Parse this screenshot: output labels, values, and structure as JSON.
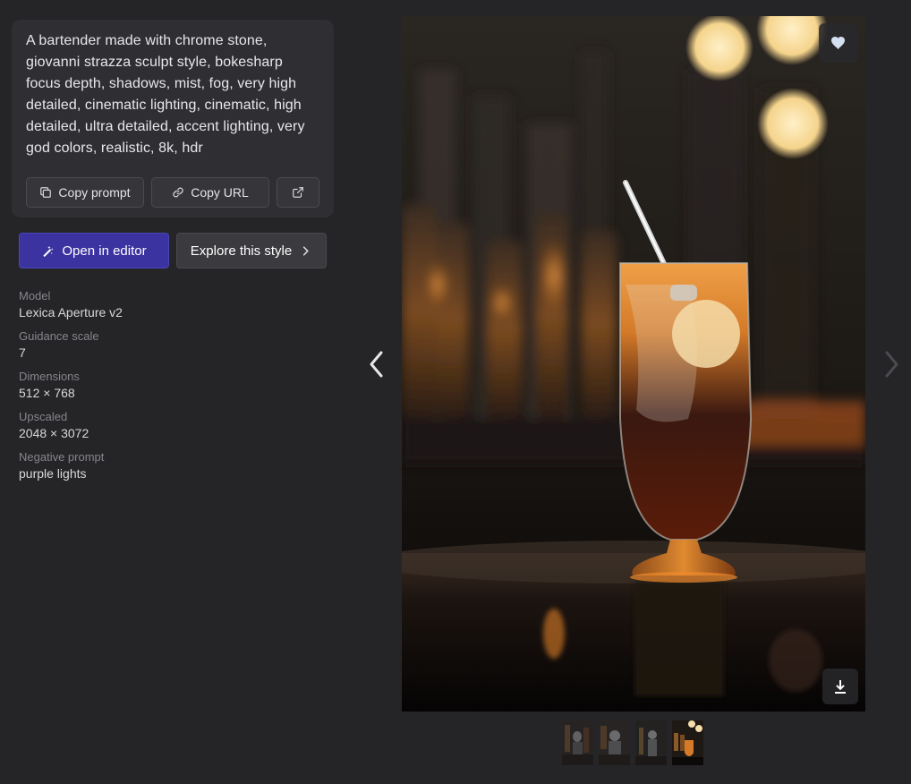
{
  "prompt": {
    "text": "A bartender made with chrome stone, giovanni strazza sculpt style, bokesharp focus depth, shadows, mist, fog, very high detailed, cinematic lighting, cinematic, high detailed, ultra detailed, accent lighting, very god colors, realistic, 8k, hdr",
    "copy_prompt_label": "Copy prompt",
    "copy_url_label": "Copy URL",
    "open_external_icon": "external-link-icon"
  },
  "actions": {
    "open_editor_label": "Open in editor",
    "explore_style_label": "Explore this style"
  },
  "meta": [
    {
      "label": "Model",
      "value": "Lexica Aperture v2"
    },
    {
      "label": "Guidance scale",
      "value": "7"
    },
    {
      "label": "Dimensions",
      "value": "512 × 768"
    },
    {
      "label": "Upscaled",
      "value": "2048 × 3072"
    },
    {
      "label": "Negative prompt",
      "value": "purple lights"
    }
  ],
  "image": {
    "favorite_icon": "heart-icon",
    "download_icon": "download-icon"
  },
  "navigation": {
    "prev_icon": "chevron-left-icon",
    "next_icon": "chevron-right-icon"
  },
  "thumbnails": {
    "count": 4,
    "active_index": 3
  },
  "colors": {
    "background": "#252528",
    "card": "#2f2f33",
    "accent": "#3a33a0"
  }
}
